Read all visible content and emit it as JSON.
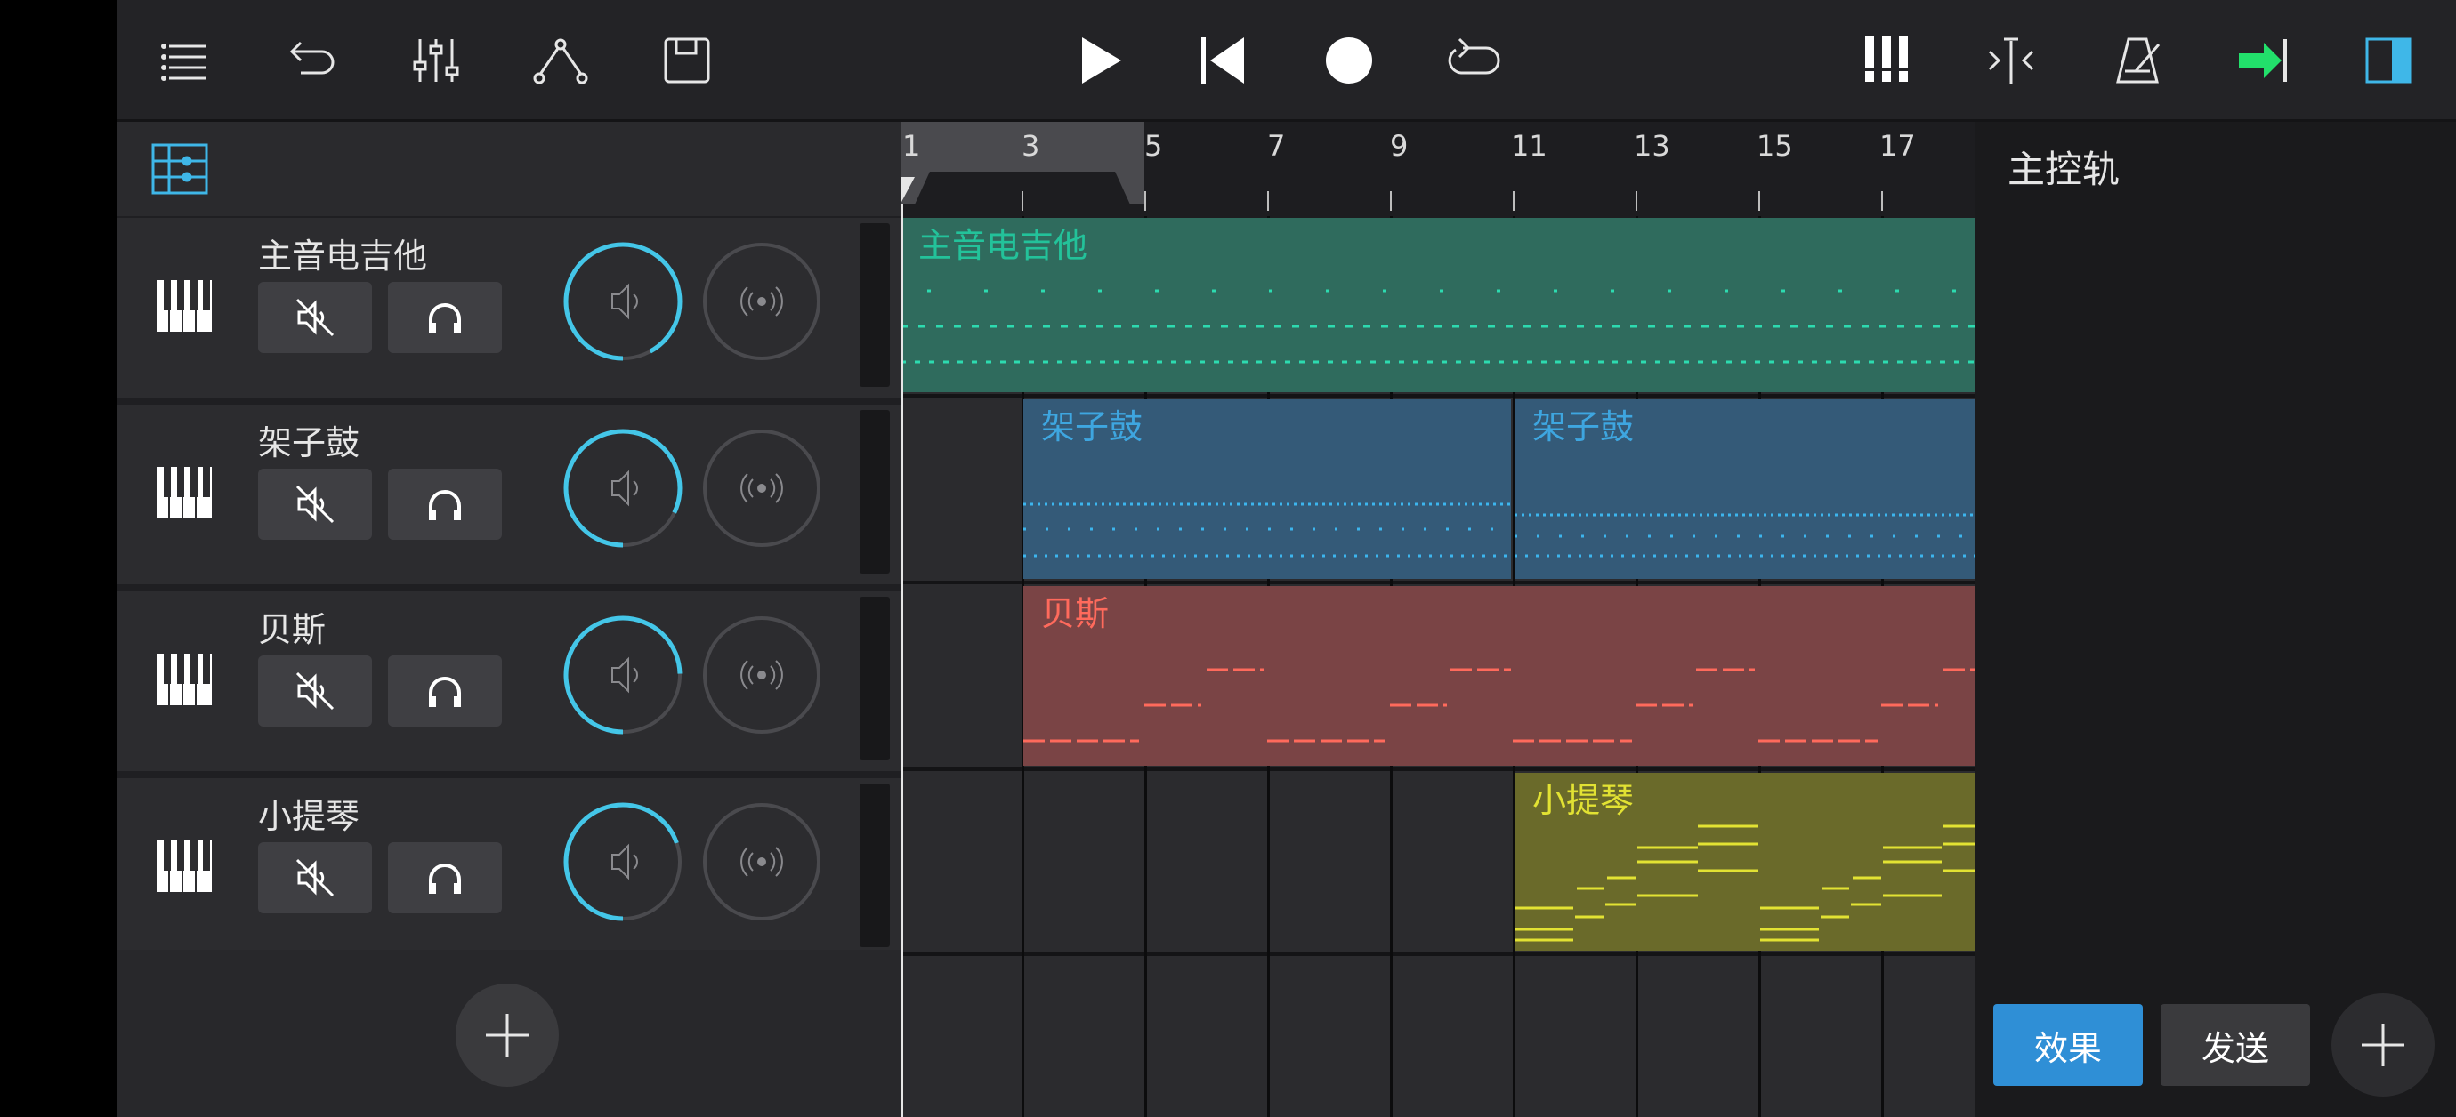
{
  "toolbar": {
    "left_icons": [
      "menu-icon",
      "undo-icon",
      "mixer-icon",
      "automation-icon",
      "save-icon"
    ],
    "center_icons": [
      "play-icon",
      "skip-to-start-icon",
      "record-icon",
      "loop-icon"
    ],
    "right_icons": [
      "piano-roll-icon",
      "split-icon",
      "metronome-icon",
      "follow-arrow-icon",
      "panel-toggle-icon"
    ],
    "accent": "#22e06b",
    "panel_toggle_color": "#3fb7e8"
  },
  "ruler": {
    "labels": [
      "1",
      "3",
      "5",
      "7",
      "9",
      "11",
      "13",
      "15",
      "17"
    ]
  },
  "tracks": [
    {
      "name": "主音电吉他",
      "clip_label": "主音电吉他",
      "color": "#1d8a6f"
    },
    {
      "name": "架子鼓",
      "clip_label": "架子鼓",
      "color": "#2a6c93"
    },
    {
      "name": "贝斯",
      "clip_label": "贝斯",
      "color": "#9a3f3f"
    },
    {
      "name": "小提琴",
      "clip_label": "小提琴",
      "color": "#8a8a1c"
    }
  ],
  "clips": {
    "drums_second": "架子鼓"
  },
  "panel": {
    "title": "主控轨",
    "effects_label": "效果",
    "send_label": "发送"
  }
}
